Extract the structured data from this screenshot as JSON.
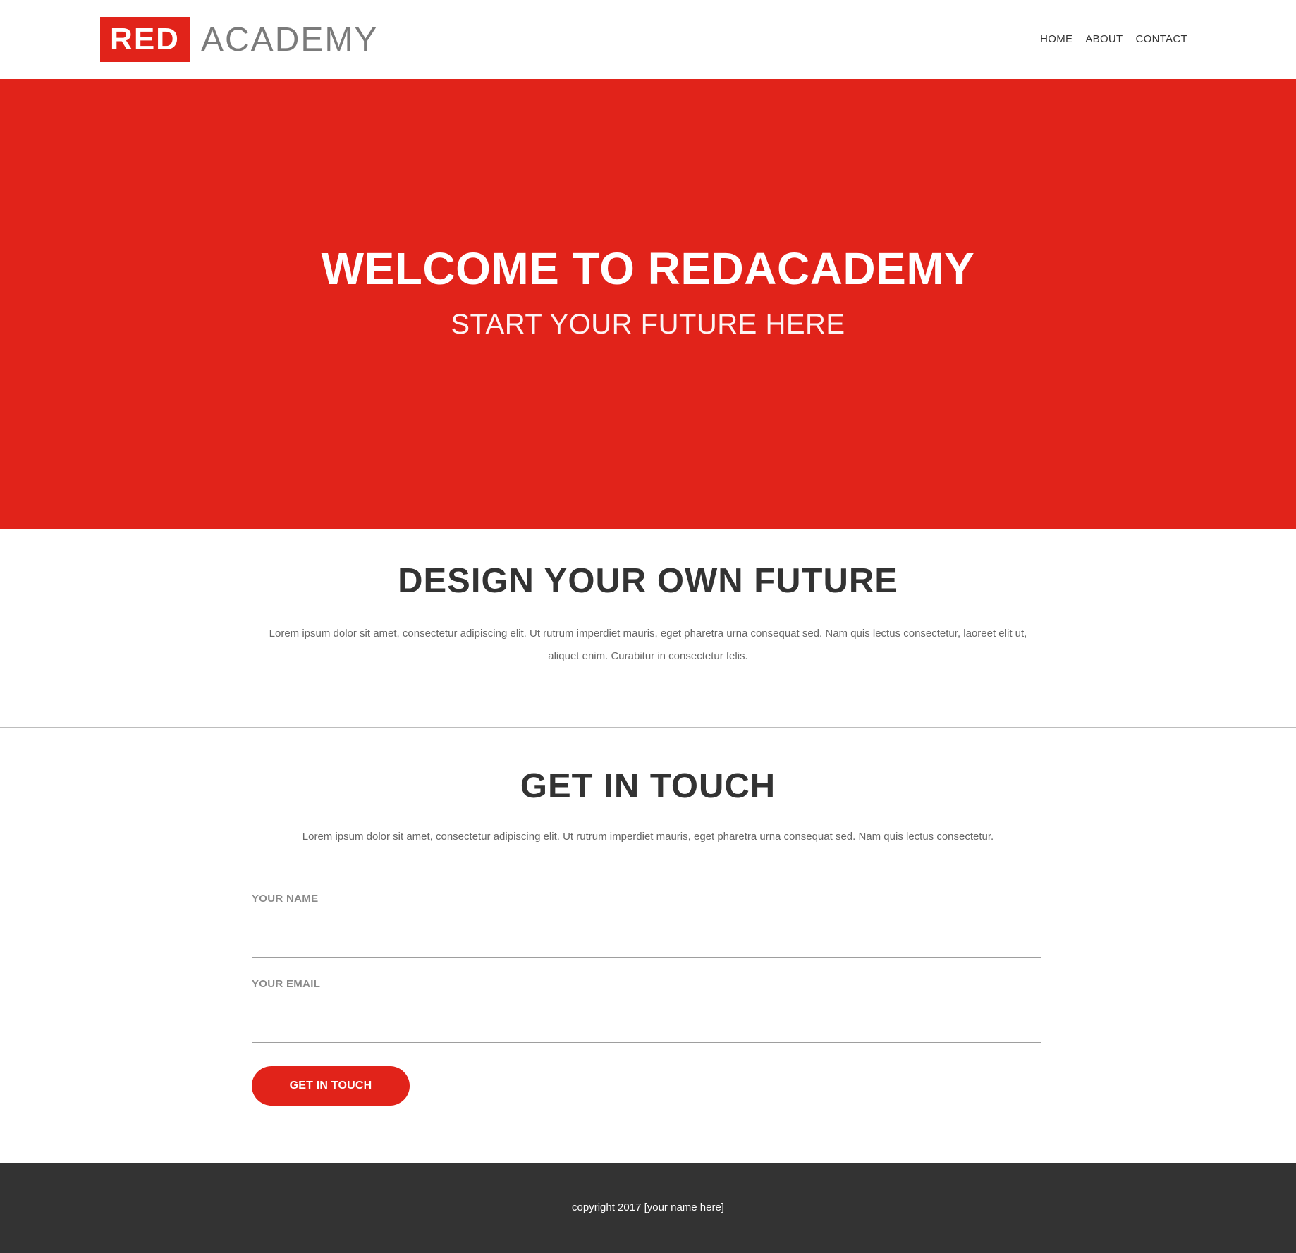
{
  "header": {
    "logo_red": "RED",
    "logo_academy": "ACADEMY",
    "nav": [
      {
        "label": "HOME"
      },
      {
        "label": "ABOUT"
      },
      {
        "label": "CONTACT"
      }
    ]
  },
  "hero": {
    "title": "WELCOME TO REDACADEMY",
    "subtitle": "START YOUR FUTURE HERE"
  },
  "design": {
    "title": "DESIGN YOUR OWN FUTURE",
    "body": "Lorem ipsum dolor sit amet, consectetur adipiscing elit. Ut rutrum imperdiet mauris, eget pharetra urna consequat sed. Nam quis lectus consectetur, laoreet elit ut, aliquet enim. Curabitur in consectetur felis."
  },
  "contact": {
    "title": "GET IN TOUCH",
    "body": "Lorem ipsum dolor sit amet, consectetur adipiscing elit. Ut rutrum imperdiet mauris, eget pharetra urna consequat sed. Nam quis lectus consectetur.",
    "name_label": "YOUR NAME",
    "name_value": "",
    "email_label": "YOUR EMAIL",
    "email_value": "",
    "submit_label": "GET IN TOUCH"
  },
  "footer": {
    "text": "copyright 2017 [your name here]"
  },
  "colors": {
    "brand_red": "#e1231a",
    "text_dark": "#333333",
    "footer_bg": "#333333"
  }
}
